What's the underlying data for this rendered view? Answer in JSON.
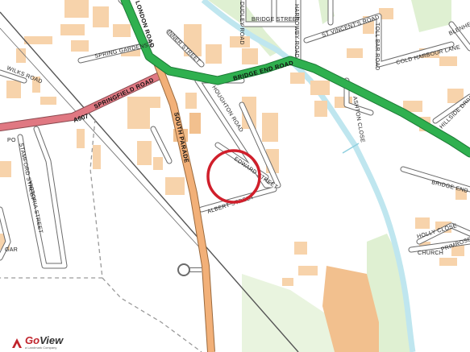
{
  "map": {
    "road_labels": {
      "london_road": "LONDON ROAD",
      "bridge_end_road": "BRIDGE END ROAD",
      "springfield_road": "SPRINGFIELD ROAD",
      "a607": "A607",
      "south_parade": "SOUTH PARADE",
      "houghton_road": "HOUGHTON ROAD",
      "inner_street": "INNER STREET",
      "spring_gardens": "SPRING GARDENS",
      "bridge_street": "BRIDGE STREET",
      "st_vincents_road": "ST VINCENT'S ROAD",
      "harrowby_road": "HARROWBY ROAD",
      "toll_bar_road": "TOLL BAR ROAD",
      "dudley_road": "DUDLEY ROAD",
      "cold_harbour_lane": "COLD HARBOUR LANE",
      "blenheim": "BLENHEIM",
      "ashton_close": "ASHTON CLOSE",
      "hillside_drive": "HILLSIDE DRIVE",
      "bridge_end_grove": "BRIDGE END GROVE",
      "holly_close": "HOLLY CLOSE",
      "primrose_way": "PRIMROSE WAY",
      "church": "CHURCH",
      "wilks_road": "WILKS ROAD",
      "stamford_street": "STAMFORD STREET",
      "victoria_street": "VICTORIA STREET",
      "edward_street": "EDWARD STREET",
      "albert_street": "ALBERT STREET",
      "po": "PO",
      "gar": "GAR"
    },
    "colors": {
      "background": "#ffffff",
      "building": "#f7d3ab",
      "building_dark": "#f2c08e",
      "a_road": "#2fb04f",
      "a_road_casing": "#1d7a36",
      "b_road": "#f2b078",
      "b_road_casing": "#9a6a3e",
      "secondary_red": "#e07882",
      "minor_road_casing": "#6b6b6b",
      "railway": "#555555",
      "river": "#bfe6ef",
      "green_area": "#d9efcf",
      "marker_circle": "#d01f2b"
    },
    "marker": {
      "label": "Property location",
      "shape": "circle"
    }
  },
  "brand": {
    "name_prefix": "Go",
    "name_suffix": "View",
    "tagline": "a Landmark Company"
  }
}
